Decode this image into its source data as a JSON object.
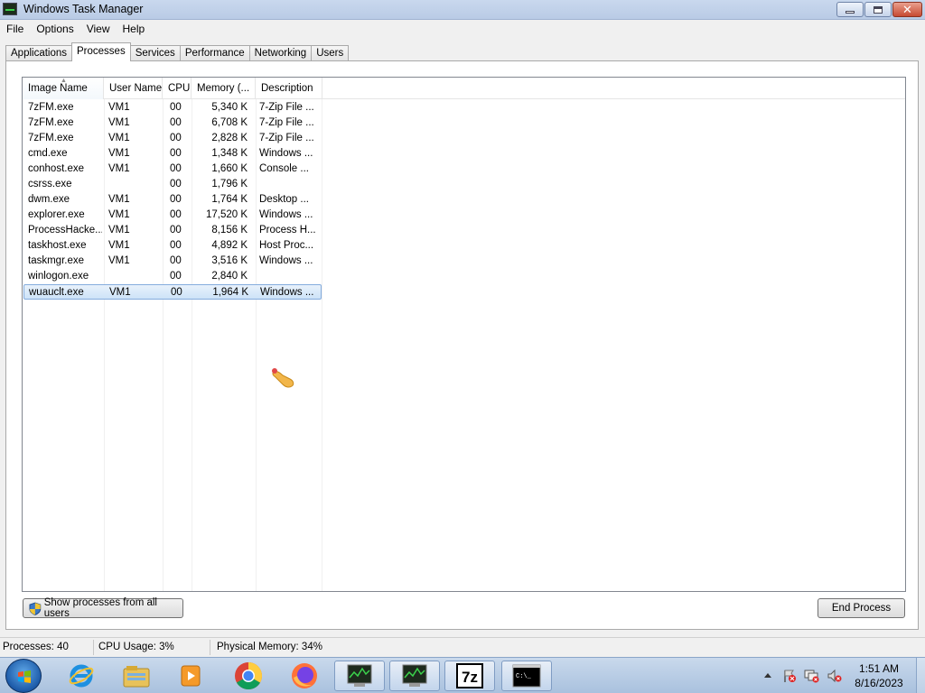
{
  "window": {
    "title": "Windows Task Manager"
  },
  "menu": [
    "File",
    "Options",
    "View",
    "Help"
  ],
  "tabs": [
    "Applications",
    "Processes",
    "Services",
    "Performance",
    "Networking",
    "Users"
  ],
  "active_tab": "Processes",
  "columns": [
    "Image Name",
    "User Name",
    "CPU",
    "Memory (...",
    "Description"
  ],
  "processes": [
    {
      "image": "7zFM.exe",
      "user": "VM1",
      "cpu": "00",
      "memory": "5,340 K",
      "description": "7-Zip File ..."
    },
    {
      "image": "7zFM.exe",
      "user": "VM1",
      "cpu": "00",
      "memory": "6,708 K",
      "description": "7-Zip File ..."
    },
    {
      "image": "7zFM.exe",
      "user": "VM1",
      "cpu": "00",
      "memory": "2,828 K",
      "description": "7-Zip File ..."
    },
    {
      "image": "cmd.exe",
      "user": "VM1",
      "cpu": "00",
      "memory": "1,348 K",
      "description": "Windows ..."
    },
    {
      "image": "conhost.exe",
      "user": "VM1",
      "cpu": "00",
      "memory": "1,660 K",
      "description": "Console ..."
    },
    {
      "image": "csrss.exe",
      "user": "",
      "cpu": "00",
      "memory": "1,796 K",
      "description": ""
    },
    {
      "image": "dwm.exe",
      "user": "VM1",
      "cpu": "00",
      "memory": "1,764 K",
      "description": "Desktop ..."
    },
    {
      "image": "explorer.exe",
      "user": "VM1",
      "cpu": "00",
      "memory": "17,520 K",
      "description": "Windows ..."
    },
    {
      "image": "ProcessHacke...",
      "user": "VM1",
      "cpu": "00",
      "memory": "8,156 K",
      "description": "Process H..."
    },
    {
      "image": "taskhost.exe",
      "user": "VM1",
      "cpu": "00",
      "memory": "4,892 K",
      "description": "Host Proc..."
    },
    {
      "image": "taskmgr.exe",
      "user": "VM1",
      "cpu": "00",
      "memory": "3,516 K",
      "description": "Windows ..."
    },
    {
      "image": "winlogon.exe",
      "user": "",
      "cpu": "00",
      "memory": "2,840 K",
      "description": ""
    },
    {
      "image": "wuauclt.exe",
      "user": "VM1",
      "cpu": "00",
      "memory": "1,964 K",
      "description": "Windows ..."
    }
  ],
  "selected_process": "wuauclt.exe",
  "buttons": {
    "show_all": "Show processes from all users",
    "end_process": "End Process"
  },
  "status": {
    "processes": "Processes: 40",
    "cpu": "CPU Usage: 3%",
    "memory": "Physical Memory: 34%"
  },
  "taskbar": {
    "icons": [
      "windows-start-icon",
      "internet-explorer-icon",
      "file-explorer-icon",
      "media-player-icon",
      "chrome-icon",
      "firefox-icon",
      "task-manager-icon",
      "task-manager-icon",
      "7zip-icon",
      "command-prompt-icon"
    ],
    "clock_time": "1:51 AM",
    "clock_date": "8/16/2023",
    "sevenzip_label": "7z",
    "cmd_label": "C:\\_"
  },
  "colors": {
    "selection": "#cde3f8",
    "taskbar": "#b4c9e3",
    "close_button": "#c74a32"
  }
}
